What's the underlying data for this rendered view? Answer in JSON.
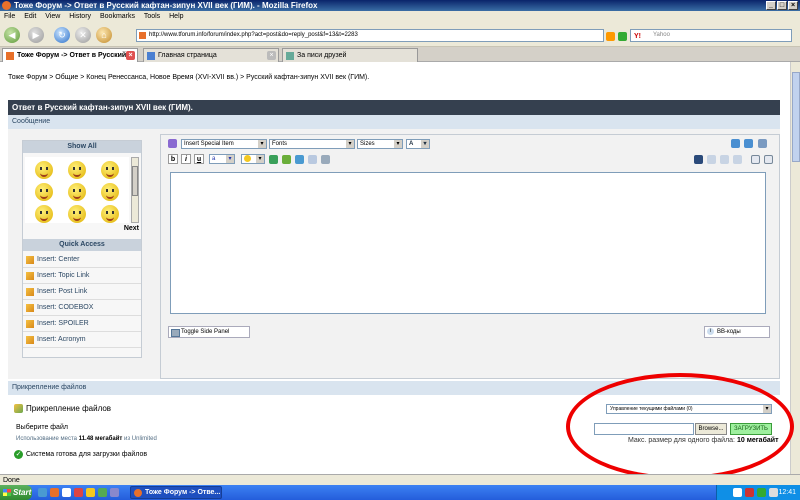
{
  "window": {
    "title": "Тоже Форум -> Ответ в Русский кафтан-зипун XVII век (ГИМ). - Mozilla Firefox"
  },
  "menu": [
    "File",
    "Edit",
    "View",
    "History",
    "Bookmarks",
    "Tools",
    "Help"
  ],
  "nav": {
    "url": "http://www.tforum.info/forum/index.php?act=post&do=reply_post&f=13&t=2283",
    "search_placeholder": "Yahoo"
  },
  "tabs": [
    {
      "label": "Тоже Форум -> Ответ в Русский...",
      "active": true
    },
    {
      "label": "Главная страница",
      "active": false
    },
    {
      "label": "За писи друзей",
      "active": false
    }
  ],
  "breadcrumb": "Тоже Форум > Общие > Конец Ренессанса, Новое Время (XVI-XVII вв.) > Русский кафтан-зипун XVII век (ГИМ).",
  "reply": {
    "header": "Ответ в Русский кафтан-зипун XVII век (ГИМ).",
    "section": "Сообщение"
  },
  "sidepanel": {
    "show_all": "Show All",
    "next": "Next",
    "quick_access": "Quick Access",
    "items": [
      "Insert: Center",
      "Insert: Topic Link",
      "Insert: Post Link",
      "Insert: CODEBOX",
      "Insert: SPOILER",
      "Insert: Acronym"
    ]
  },
  "editor": {
    "special_item": "Insert Special Item",
    "fonts": "Fonts",
    "sizes": "Sizes",
    "toggle_side_panel": "Toggle Side Panel",
    "bbcodes": "BB-коды",
    "format_buttons": [
      "b",
      "i",
      "u"
    ]
  },
  "attachments": {
    "bar": "Прикрепление файлов",
    "title": "Прикрепление файлов",
    "manage": "Управление текущими файлами (0)",
    "choose": "Выберите файл",
    "usage_prefix": "Использование места",
    "usage_value": "11.48 мегабайт",
    "usage_suffix": "из Unlimited",
    "ready": "Система готова для загрузки файлов",
    "browse": "Browse...",
    "upload": "ЗАГРУЗИТЬ",
    "max_prefix": "Макс. размер для одного файла:",
    "max_value": "10 мегабайт"
  },
  "status": "Done",
  "taskbar": {
    "start": "Start",
    "item": "Тоже Форум -> Отве...",
    "lang": "EN",
    "clock": "12:41"
  }
}
